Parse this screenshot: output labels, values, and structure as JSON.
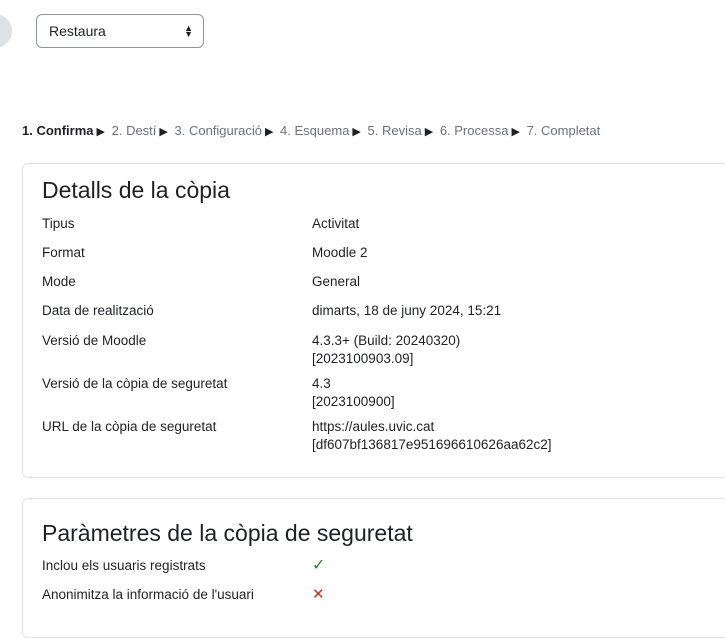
{
  "restore_select": {
    "value": "Restaura"
  },
  "steps": [
    {
      "label": "1. Confirma",
      "current": true
    },
    {
      "label": "2. Destí"
    },
    {
      "label": "3. Configuració"
    },
    {
      "label": "4. Esquema"
    },
    {
      "label": "5. Revisa"
    },
    {
      "label": "6. Processa"
    },
    {
      "label": "7. Completat"
    }
  ],
  "details": {
    "title": "Detalls de la còpia",
    "rows": [
      {
        "label": "Tipus",
        "value": "Activitat"
      },
      {
        "label": "Format",
        "value": "Moodle 2"
      },
      {
        "label": "Mode",
        "value": "General"
      },
      {
        "label": "Data de realització",
        "value": "dimarts, 18 de juny 2024, 15:21"
      },
      {
        "label": "Versió de Moodle",
        "value": "4.3.3+ (Build: 20240320)",
        "value2": "[2023100903.09]"
      },
      {
        "label": "Versió de la còpia de seguretat",
        "value": "4.3",
        "value2": "[2023100900]"
      },
      {
        "label": "URL de la còpia de seguretat",
        "value": "https://aules.uvic.cat",
        "value2": "[df607bf136817e951696610626aa62c2]"
      }
    ]
  },
  "params": {
    "title": "Paràmetres de la còpia de seguretat",
    "rows": [
      {
        "label": "Inclou els usuaris registrats",
        "status": "yes",
        "icon": "check-icon"
      },
      {
        "label": "Anonimitza la informació de l'usuari",
        "status": "no",
        "icon": "cross-icon"
      }
    ]
  }
}
